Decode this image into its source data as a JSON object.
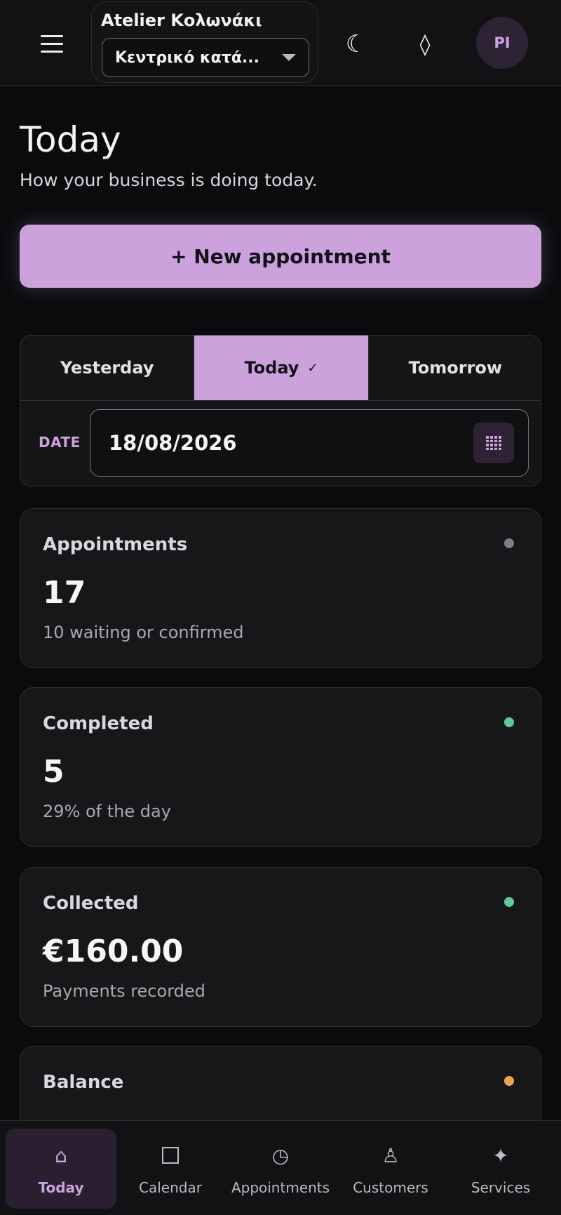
{
  "header": {
    "brand_name": "Atelier Κολωνάκι",
    "branch_selected": "Κεντρικό κατά...",
    "avatar_initials": "PI",
    "icons": [
      "menu-icon",
      "moon-icon",
      "diamond-icon"
    ]
  },
  "page": {
    "title": "Today",
    "subtitle": "How your business is doing today."
  },
  "new_appointment_label": "+ New appointment",
  "day_selector": {
    "tabs": [
      {
        "label": "Yesterday"
      },
      {
        "label": "Today",
        "active": true
      },
      {
        "label": "Tomorrow"
      }
    ],
    "date_label": "DATE",
    "date_value": "18/08/2026"
  },
  "stats": [
    {
      "label": "Appointments",
      "value": "17",
      "note": "10 waiting or confirmed",
      "dot_color": "#7e7e86"
    },
    {
      "label": "Completed",
      "value": "5",
      "note": "29% of the day",
      "dot_color": "#62c99a"
    },
    {
      "label": "Collected",
      "value": "€160.00",
      "note": "Payments recorded",
      "dot_color": "#62c99a"
    },
    {
      "label": "Balance",
      "value": "",
      "note": "",
      "dot_color": "#e6a64e"
    }
  ],
  "bottom_nav": [
    {
      "label": "Today",
      "icon": "home-icon",
      "active": true
    },
    {
      "label": "Calendar",
      "icon": "calendar-square-icon"
    },
    {
      "label": "Appointments",
      "icon": "clock-icon"
    },
    {
      "label": "Customers",
      "icon": "customer-icon"
    },
    {
      "label": "Services",
      "icon": "sparkle-icon"
    }
  ],
  "colors": {
    "accent": "#cca2dd",
    "background": "#0b0b0d",
    "card": "#17171a"
  }
}
